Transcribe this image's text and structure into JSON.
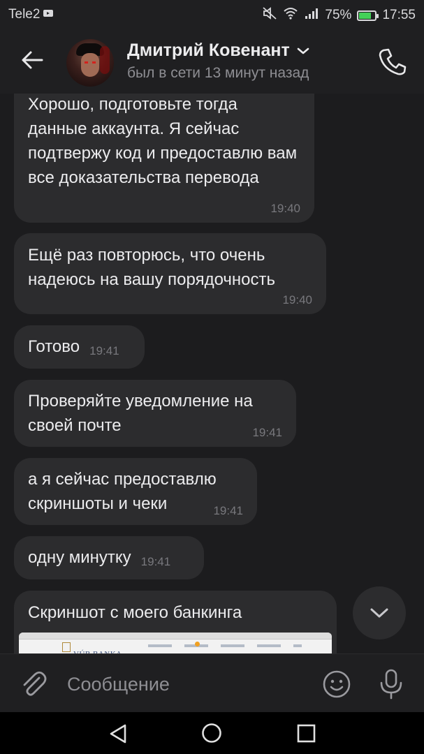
{
  "status_bar": {
    "carrier": "Tele2",
    "battery_percent": "75%",
    "battery_level": 0.75,
    "time": "17:55"
  },
  "header": {
    "contact_name": "Дмитрий Ковенант",
    "last_seen": "был в сети 13 минут назад"
  },
  "messages": [
    {
      "text": "Хорошо, подготовьте тогда данные аккаунта. Я сейчас подтвержу код и предоставлю вам все доказательства перевода",
      "time": "19:40"
    },
    {
      "text": "Ещё раз повторюсь, что очень надеюсь на вашу порядочность",
      "time": "19:40"
    },
    {
      "text": "Готово",
      "time": "19:41"
    },
    {
      "text": "Проверяйте уведомление на своей почте",
      "time": "19:41"
    },
    {
      "text": "а я сейчас предоставлю скриншоты и чеки",
      "time": "19:41"
    },
    {
      "text": "одну минутку",
      "time": "19:41"
    },
    {
      "text": "Скриншот с моего банкинга",
      "attachment_logo": "VÚB BANKA"
    }
  ],
  "composer": {
    "placeholder": "Сообщение"
  },
  "icons": {
    "back": "arrow-left-icon",
    "call": "phone-icon",
    "attach": "paperclip-icon",
    "emoji": "smiley-icon",
    "mic": "microphone-icon",
    "scroll_down": "chevron-down-icon"
  },
  "colors": {
    "background": "#1c1c1e",
    "bubble": "#2c2c2e",
    "battery_fill": "#43d158"
  }
}
